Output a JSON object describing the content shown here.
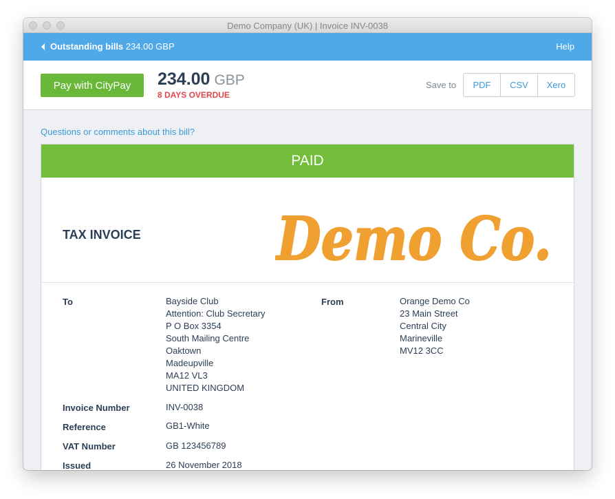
{
  "window": {
    "title": "Demo Company (UK) | Invoice INV-0038"
  },
  "nav": {
    "back_label": "Outstanding bills",
    "back_amount": "234.00 GBP",
    "help": "Help"
  },
  "payment": {
    "pay_button": "Pay with CityPay",
    "amount": "234.00",
    "currency": "GBP",
    "status": "8 DAYS OVERDUE",
    "save_to_label": "Save to",
    "save_options": [
      "PDF",
      "CSV",
      "Xero"
    ]
  },
  "questions_link": "Questions or comments about this bill?",
  "invoice": {
    "paid_banner": "PAID",
    "title": "TAX INVOICE",
    "logo_text": "Demo Co.",
    "to_label": "To",
    "to_address": [
      "Bayside Club",
      "Attention: Club Secretary",
      "P O Box 3354",
      "South Mailing Centre",
      "Oaktown",
      "Madeupville",
      "MA12 VL3",
      "UNITED KINGDOM"
    ],
    "from_label": "From",
    "from_address": [
      "Orange Demo Co",
      "23 Main Street",
      "Central City",
      "Marineville",
      "MV12 3CC"
    ],
    "fields": [
      {
        "label": "Invoice Number",
        "value": "INV-0038"
      },
      {
        "label": "Reference",
        "value": "GB1-White"
      },
      {
        "label": "VAT Number",
        "value": "GB 123456789"
      },
      {
        "label": "Issued",
        "value": "26 November 2018"
      }
    ]
  },
  "colors": {
    "accent_blue": "#4fa8e8",
    "pay_green": "#6ab839",
    "paid_green": "#72be3a",
    "overdue_red": "#e0474c",
    "logo_orange": "#f0a030"
  }
}
